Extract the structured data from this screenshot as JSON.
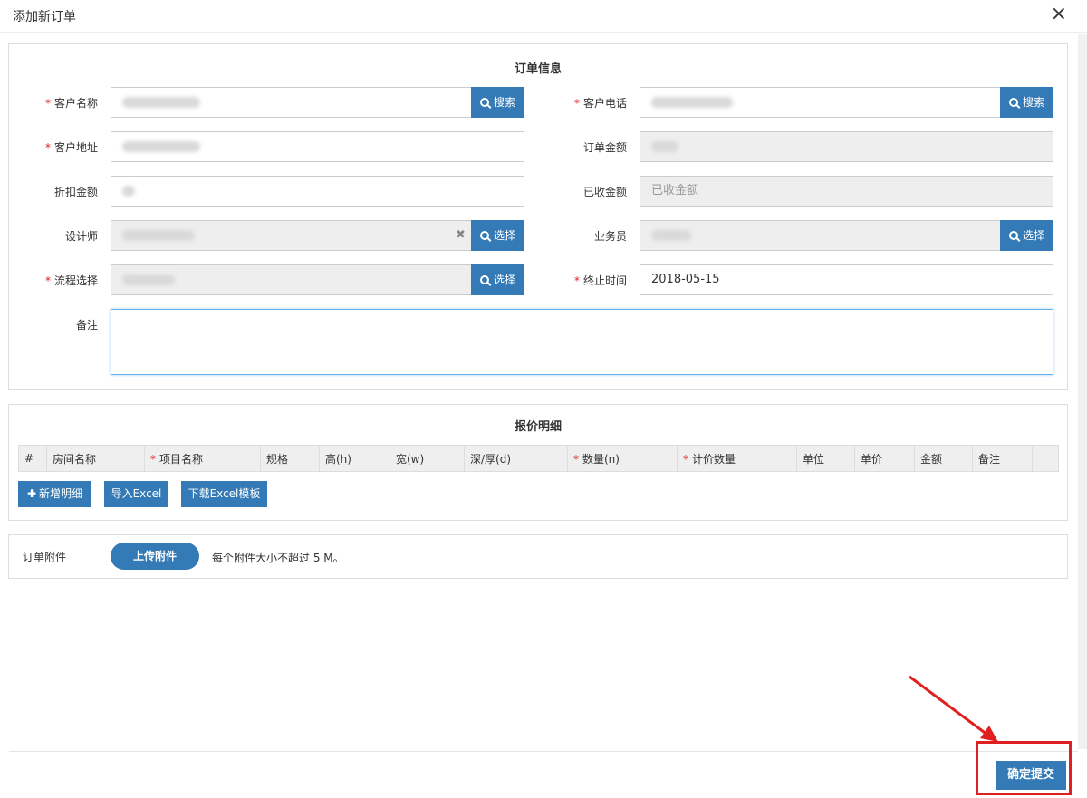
{
  "dialog": {
    "title": "添加新订单",
    "close_glyph": "×"
  },
  "order_info": {
    "section_title": "订单信息",
    "customer_name": {
      "label": "客户名称",
      "required": true
    },
    "customer_phone": {
      "label": "客户电话",
      "required": true
    },
    "customer_address": {
      "label": "客户地址",
      "required": true
    },
    "order_amount": {
      "label": "订单金额",
      "required": false
    },
    "discount_amount": {
      "label": "折扣金额",
      "required": false
    },
    "received_amount": {
      "label": "已收金额",
      "required": false,
      "placeholder": "已收金额"
    },
    "designer": {
      "label": "设计师",
      "required": false,
      "clear_glyph": "✖"
    },
    "salesperson": {
      "label": "业务员",
      "required": false
    },
    "workflow": {
      "label": "流程选择",
      "required": true
    },
    "end_time": {
      "label": "终止时间",
      "required": true,
      "value": "2018-05-15"
    },
    "remark": {
      "label": "备注"
    },
    "search_button": "搜索",
    "select_button": "选择",
    "required_mark": "*"
  },
  "quote_details": {
    "section_title": "报价明细",
    "columns": [
      "#",
      "房间名称",
      "项目名称",
      "规格",
      "高(h)",
      "宽(w)",
      "深/厚(d)",
      "数量(n)",
      "计价数量",
      "单位",
      "单价",
      "金额",
      "备注"
    ],
    "add_button": "新增明细",
    "add_glyph": "✚",
    "import_button": "导入Excel",
    "download_button": "下载Excel模板"
  },
  "attachment": {
    "label": "订单附件",
    "upload_button": "上传附件",
    "hint": "每个附件大小不超过 5 M。"
  },
  "footer": {
    "submit_button": "确定提交"
  },
  "colors": {
    "primary": "#337ab7",
    "required": "#e02020",
    "annotation": "#e02020"
  }
}
